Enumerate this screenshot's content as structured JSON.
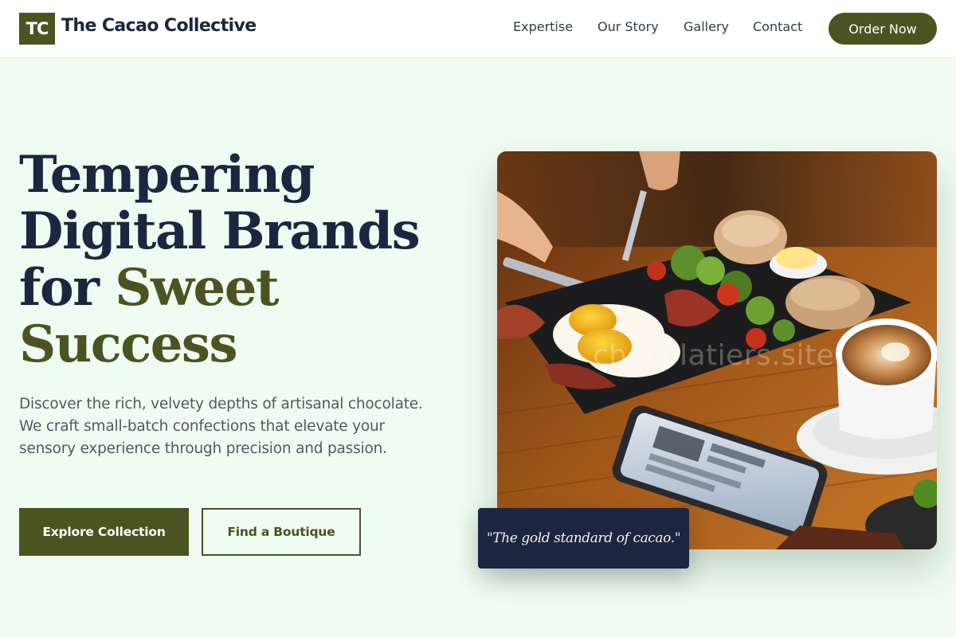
{
  "brand": {
    "monogram": "TC",
    "name": "The Cacao Collective"
  },
  "nav": {
    "items": [
      {
        "label": "Expertise"
      },
      {
        "label": "Our Story"
      },
      {
        "label": "Gallery"
      },
      {
        "label": "Contact"
      }
    ],
    "cta_label": "Order Now"
  },
  "hero": {
    "title_part1": "Tempering Digital Brands for ",
    "title_accent": "Sweet Success",
    "description": "Discover the rich, velvety depths of artisanal chocolate. We craft small-batch confections that elevate your sensory experience through precision and passion.",
    "primary_button": "Explore Collection",
    "secondary_button": "Find a Boutique",
    "quote": "\"The gold standard of cacao.\"",
    "watermark": "chocolatiers.site"
  },
  "colors": {
    "brand_olive": "#4b5320",
    "navy": "#1c2640",
    "page_background": "#effcf1",
    "header_background": "#ffffff"
  },
  "icons": {
    "logo": "monogram-square"
  }
}
